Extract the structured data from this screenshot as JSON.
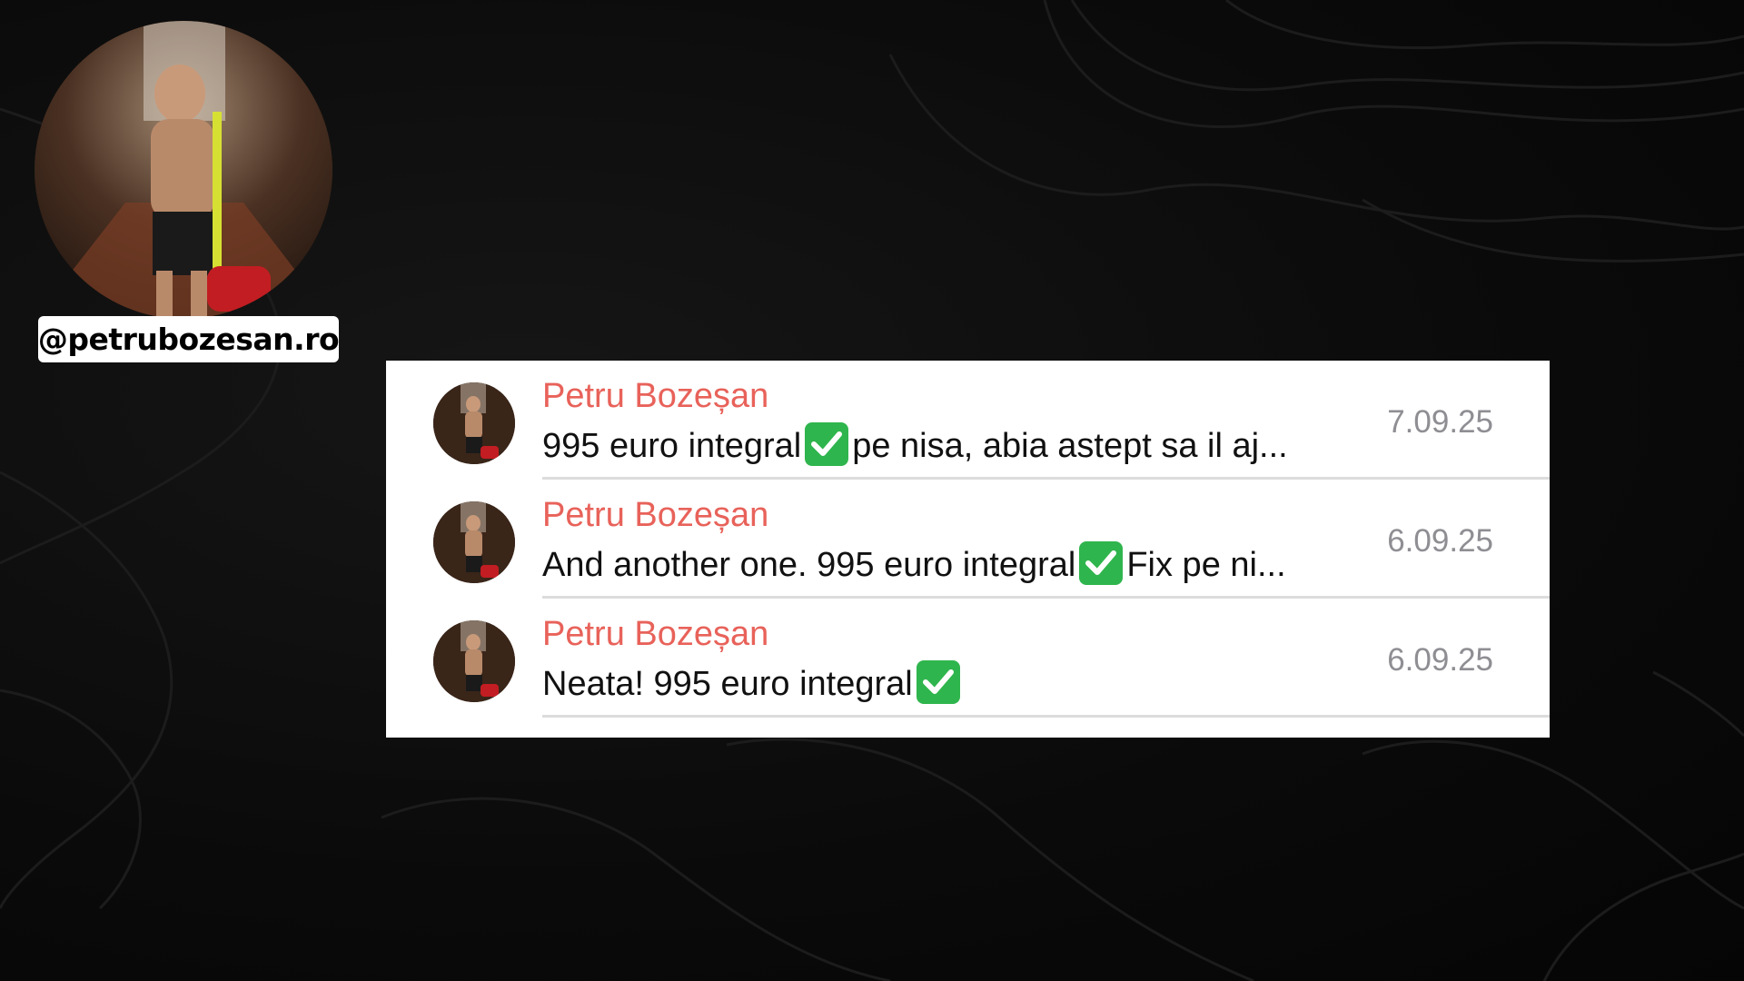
{
  "profile": {
    "handle": "@petrubozesan.ro",
    "avatar_icon": "profile-photo-icon"
  },
  "chats": [
    {
      "sender": "Petru Bozeșan",
      "preview_before": "995 euro integral",
      "preview_after": " pe nisa, abia astept sa il aj...",
      "date": "7.09.25"
    },
    {
      "sender": "Petru Bozeșan",
      "preview_before": "And another one. 995 euro integral",
      "preview_after": " Fix pe ni...",
      "date": "6.09.25"
    },
    {
      "sender": "Petru Bozeșan",
      "preview_before": "Neata! 995 euro integral",
      "preview_after": "",
      "date": "6.09.25"
    }
  ],
  "colors": {
    "sender_name": "#e8625a",
    "check_green": "#2fb54d",
    "date_gray": "#8e8e93",
    "background": "#0b0b0b"
  }
}
